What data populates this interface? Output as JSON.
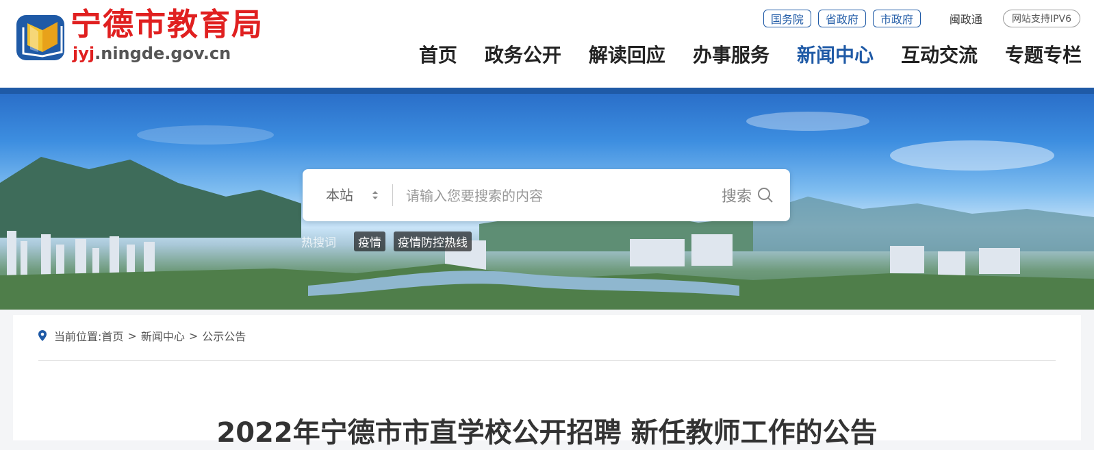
{
  "colors": {
    "brand_red": "#e02020",
    "nav_blue": "#1f5aa6",
    "bar_blue": "#1f5aa6"
  },
  "header": {
    "site_title": "宁德市教育局",
    "domain_part1": "jyj",
    "domain_part2": ".ningde.gov.cn",
    "top_links": [
      "国务院",
      "省政府",
      "市政府"
    ],
    "minzhengtong": "闽政通",
    "ipv6": "网站支持IPV6",
    "nav": [
      {
        "label": "首页"
      },
      {
        "label": "政务公开"
      },
      {
        "label": "解读回应"
      },
      {
        "label": "办事服务"
      },
      {
        "label": "新闻中心",
        "active": true
      },
      {
        "label": "互动交流"
      },
      {
        "label": "专题专栏"
      }
    ]
  },
  "search": {
    "scope": "本站",
    "placeholder": "请输入您要搜索的内容",
    "button": "搜索",
    "hot_label": "热搜词",
    "hot_words": [
      "疫情",
      "疫情防控热线"
    ]
  },
  "breadcrumb": {
    "prefix": "当前位置:",
    "items": [
      "首页",
      "新闻中心",
      "公示公告"
    ],
    "separator": ">"
  },
  "article": {
    "title": "2022年宁德市市直学校公开招聘 新任教师工作的公告"
  }
}
